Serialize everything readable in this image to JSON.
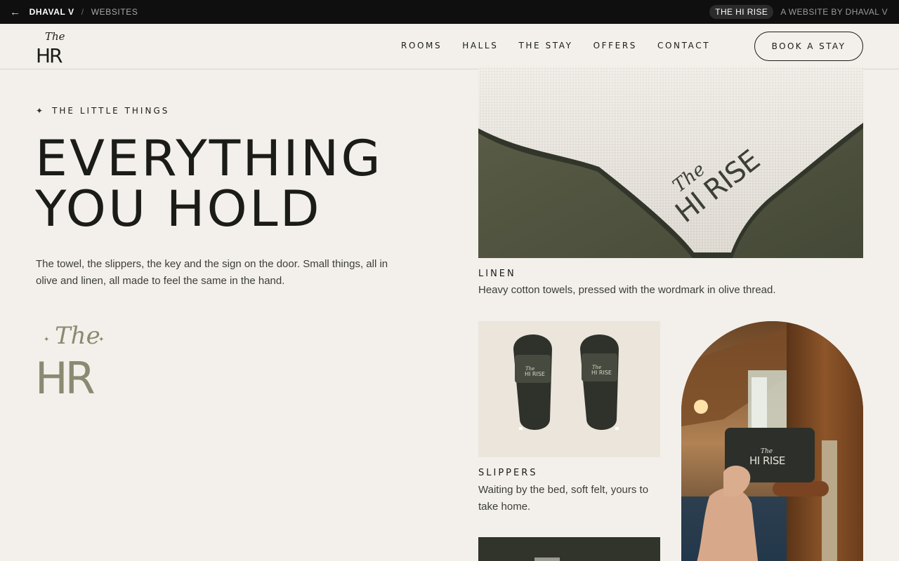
{
  "topbar": {
    "back_glyph": "←",
    "owner": "DHAVAL V",
    "separator": "/",
    "section": "WEBSITES",
    "pill": "THE HI RISE",
    "credit": "A WEBSITE BY DHAVAL V"
  },
  "nav": {
    "logo_script": "The",
    "logo_mark": "HR",
    "links": [
      "ROOMS",
      "HALLS",
      "THE STAY",
      "OFFERS",
      "CONTACT"
    ],
    "cta": "BOOK A STAY"
  },
  "hero": {
    "eyebrow_icon": "sparkle-icon",
    "eyebrow": "THE LITTLE THINGS",
    "headline_line1": "EVERYTHING",
    "headline_line2": "YOU HOLD",
    "lede": "The towel, the slippers, the key and the sign on the door. Small things, all in olive and linen, all made to feel the same in the hand.",
    "logo_script": "The",
    "logo_mark": "HR"
  },
  "items": [
    {
      "title": "LINEN",
      "text": "Heavy cotton towels, pressed with the wordmark in olive thread.",
      "image_mark_script": "The",
      "image_mark": "HI RISE"
    },
    {
      "title": "SLIPPERS",
      "text": "Waiting by the bed, soft felt, yours to take home.",
      "image_mark_script": "The",
      "image_mark": "HI RISE"
    }
  ],
  "key_card": {
    "script": "The",
    "mark": "HI RISE"
  },
  "colors": {
    "background": "#f3f0eb",
    "ink": "#1b1c17",
    "olive": "#4e5240",
    "strip": "#0f0f0f"
  }
}
